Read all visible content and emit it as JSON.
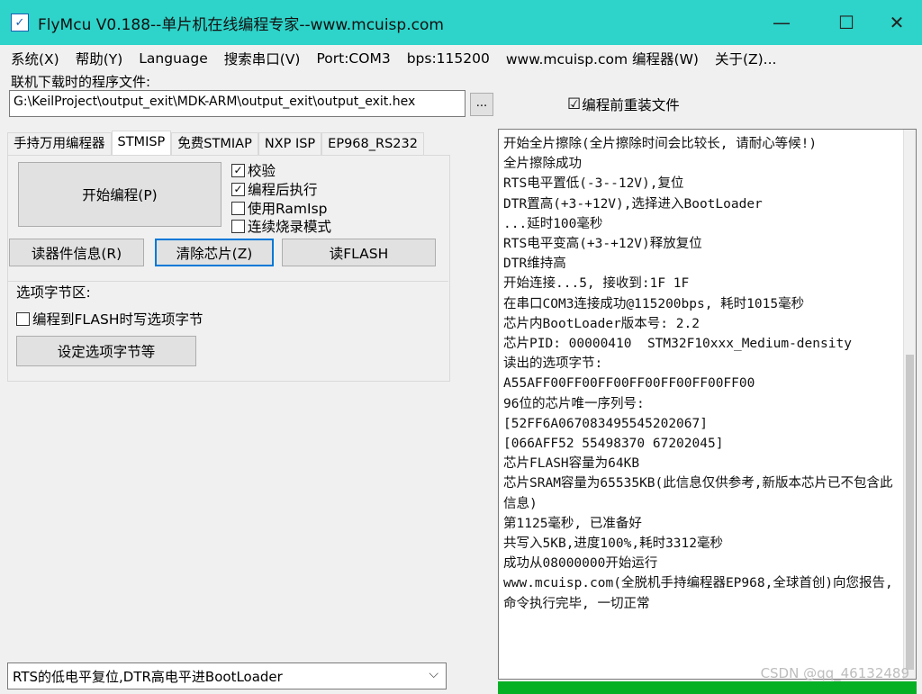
{
  "window": {
    "title": "FlyMcu V0.188--单片机在线编程专家--www.mcuisp.com",
    "app_icon": "✓",
    "minimize": "—",
    "maximize": "☐",
    "close": "✕"
  },
  "menu": [
    "系统(X)",
    "帮助(Y)",
    "Language",
    "搜索串口(V)",
    "Port:COM3",
    "bps:115200",
    "www.mcuisp.com 编程器(W)",
    "关于(Z)..."
  ],
  "file": {
    "label": "联机下载时的程序文件:",
    "path": "G:\\KeilProject\\output_exit\\MDK-ARM\\output_exit\\output_exit.hex",
    "browse": "...",
    "reload_label": "编程前重装文件",
    "reload_checked": "☑"
  },
  "tabs": [
    "手持万用编程器",
    "STMISP",
    "免费STMIAP",
    "NXP ISP",
    "EP968_RS232"
  ],
  "stmisp": {
    "start_button": "开始编程(P)",
    "options": [
      {
        "label": "校验",
        "mark": "✓"
      },
      {
        "label": "编程后执行",
        "mark": "✓"
      },
      {
        "label": "使用RamIsp",
        "mark": ""
      },
      {
        "label": "连续烧录模式",
        "mark": ""
      }
    ],
    "read_info_button": "读器件信息(R)",
    "erase_button": "清除芯片(Z)",
    "read_flash_button": "读FLASH",
    "option_group_label": "选项字节区:",
    "option_write_label": "编程到FLASH时写选项字节",
    "option_set_button": "设定选项字节等"
  },
  "log": [
    "开始全片擦除(全片擦除时间会比较长, 请耐心等候!)",
    "全片擦除成功",
    "RTS电平置低(-3--12V),复位",
    "DTR置高(+3-+12V),选择进入BootLoader",
    "...延时100毫秒",
    "RTS电平变高(+3-+12V)释放复位",
    "DTR维持高",
    "开始连接...5, 接收到:1F 1F",
    "在串口COM3连接成功@115200bps, 耗时1015毫秒",
    "芯片内BootLoader版本号: 2.2",
    "芯片PID: 00000410  STM32F10xxx_Medium-density",
    "读出的选项字节:",
    "A55AFF00FF00FF00FF00FF00FF00FF00",
    "96位的芯片唯一序列号:",
    "[52FF6A067083495545202067]",
    "[066AFF52 55498370 67202045]",
    "芯片FLASH容量为64KB",
    "芯片SRAM容量为65535KB(此信息仅供参考,新版本芯片已不包含此信息)",
    "第1125毫秒, 已准备好",
    "共写入5KB,进度100%,耗时3312毫秒",
    "成功从08000000开始运行",
    "www.mcuisp.com(全脱机手持编程器EP968,全球首创)向您报告, 命令执行完毕, 一切正常"
  ],
  "reset_mode": {
    "value": "RTS的低电平复位,DTR高电平进BootLoader",
    "arrow": "⌵"
  },
  "watermark": "CSDN @qq_46132489",
  "colors": {
    "titlebar": "#2ed3c9",
    "progress": "#06b025",
    "focus": "#0078d7"
  }
}
